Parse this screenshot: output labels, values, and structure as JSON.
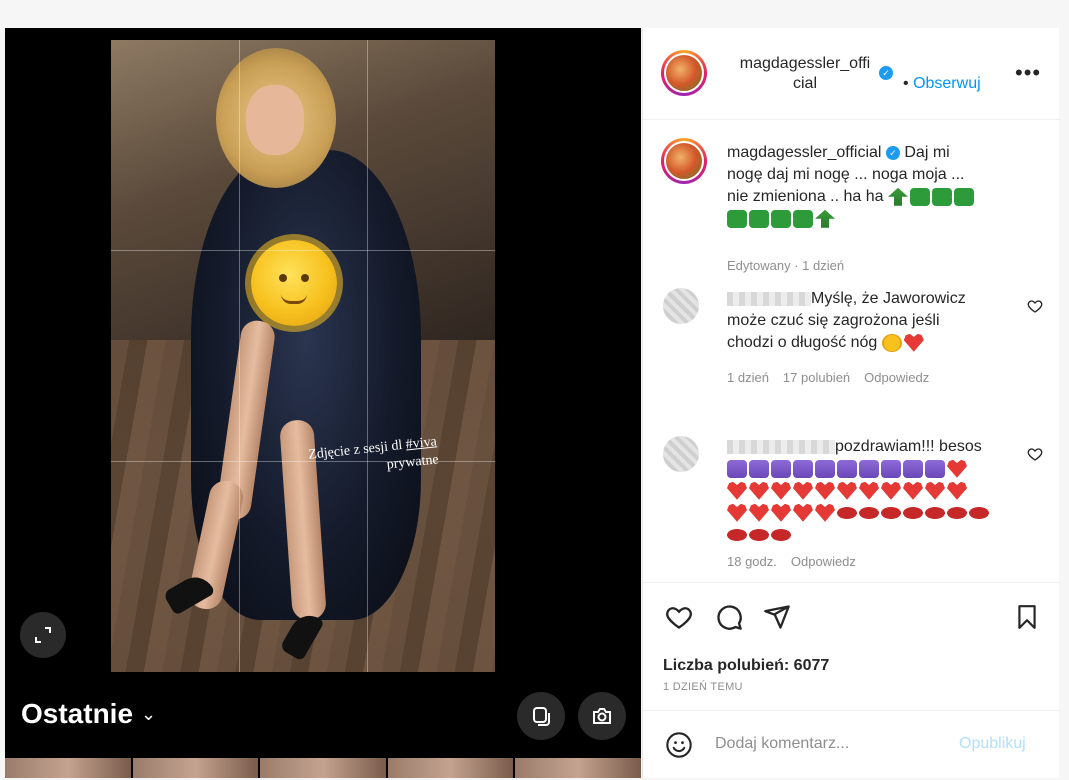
{
  "post": {
    "username_line1": "magdagessler_offi",
    "username_line2": "cial",
    "dot": "•",
    "follow": "Obserwuj",
    "more": "•••"
  },
  "media": {
    "overlay_caption_line1": "Zdjęcie z sesji dl",
    "overlay_caption_tag": "#viva",
    "overlay_caption_line2": "prywatne",
    "recent_label": "Ostatnie",
    "recent_chevron": "⌄"
  },
  "caption": {
    "username": "magdagessler_official",
    "text_line1": "Daj mi",
    "text_line2": "nogę daj mi nogę ... noga moja ...",
    "text_line3": "nie zmieniona .. ha ha",
    "edited": "Edytowany",
    "time": "1 dzień"
  },
  "comments": [
    {
      "text_line1": "Myślę, że Jaworowicz",
      "text_line2": "może czuć się zagrożona jeśli",
      "text_line3": "chodzi o długość nóg",
      "time": "1 dzień",
      "likes": "17 polubień",
      "reply": "Odpowiedz"
    },
    {
      "text_line1": "pozdrawiam!!! besos",
      "time": "18 godz.",
      "reply": "Odpowiedz"
    }
  ],
  "stats": {
    "likes": "Liczba polubień: 6077",
    "ago": "1 DZIEŃ TEMU"
  },
  "add_comment": {
    "placeholder": "Dodaj komentarz...",
    "publish": "Opublikuj"
  },
  "colors": {
    "link": "#0095f6",
    "verified": "#1d9bf0",
    "muted": "#8e8e8e",
    "publish_disabled": "#b2dffc"
  }
}
